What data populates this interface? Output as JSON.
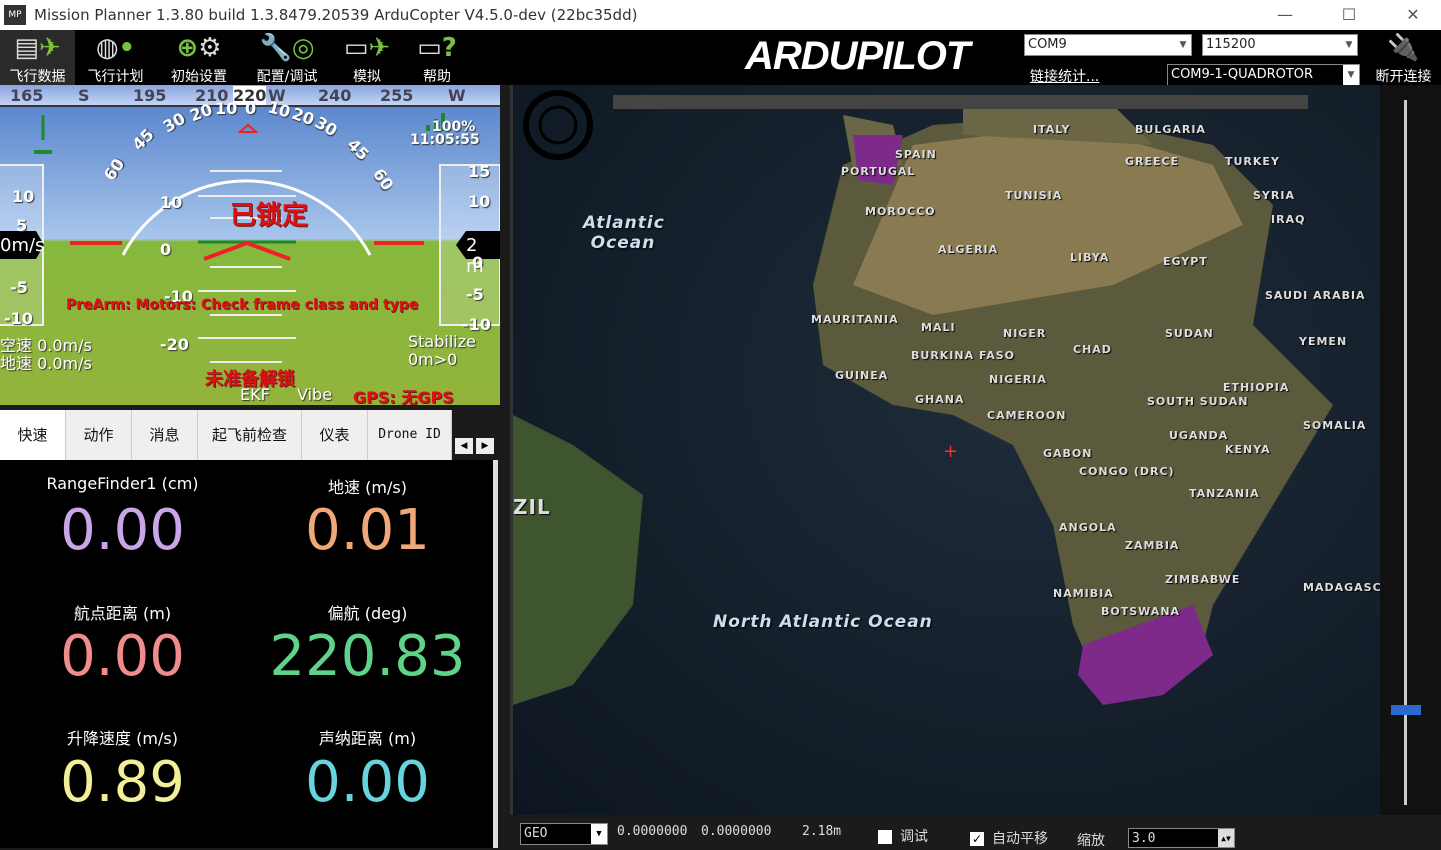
{
  "window": {
    "title": "Mission Planner 1.3.80 build 1.3.8479.20539 ArduCopter V4.5.0-dev (22bc35dd)",
    "logo": "MP",
    "minimize": "—",
    "maximize": "☐",
    "close": "✕"
  },
  "toolbar": {
    "items": [
      {
        "label": "飞行数据",
        "icon": "flight-data-icon"
      },
      {
        "label": "飞行计划",
        "icon": "globe-icon"
      },
      {
        "label": "初始设置",
        "icon": "gear-icon"
      },
      {
        "label": "配置/调试",
        "icon": "wrench-icon"
      },
      {
        "label": "模拟",
        "icon": "monitor-icon"
      },
      {
        "label": "帮助",
        "icon": "help-icon"
      }
    ],
    "brand": "ARDUPILOT",
    "port": "COM9",
    "baud": "115200",
    "link_stats": "链接统计...",
    "vehicle": "COM9-1-QUADROTOR",
    "disconnect": "断开连接"
  },
  "hud": {
    "heading_ticks": [
      "165",
      "S",
      "195",
      "210",
      "220",
      "W",
      "240",
      "255",
      "W"
    ],
    "roll_scale": [
      "60",
      "45",
      "30",
      "20",
      "10",
      "0",
      "10",
      "20",
      "30",
      "45",
      "60"
    ],
    "battery": "100%",
    "time": "11:05:55",
    "pitch": [
      "10",
      "0",
      "-10",
      "-20"
    ],
    "speed_ticks": [
      "10",
      "5",
      "-5",
      "-10"
    ],
    "speed_readout": "0m/s",
    "alt_ticks": [
      "15",
      "10",
      "0",
      "-5",
      "-10"
    ],
    "alt_readout": "2 m",
    "armed_status": "已锁定",
    "prearm": "PreArm: Motors: Check frame class and type",
    "airspeed": "空速 0.0m/s",
    "groundspeed": "地速 0.0m/s",
    "mode": "Stabilize",
    "wp": "0m>0",
    "not_ready": "未准备解锁",
    "ekf": "EKF",
    "vibe": "Vibe",
    "gps": "GPS: 无GPS"
  },
  "tabs": [
    "快速",
    "动作",
    "消息",
    "起飞前检查",
    "仪表",
    "Drone ID"
  ],
  "quick": [
    {
      "label": "RangeFinder1 (cm)",
      "value": "0.00",
      "color": "#c9a6e8"
    },
    {
      "label": "地速 (m/s)",
      "value": "0.01",
      "color": "#f0a878"
    },
    {
      "label": "航点距离 (m)",
      "value": "0.00",
      "color": "#f08c8c"
    },
    {
      "label": "偏航 (deg)",
      "value": "220.83",
      "color": "#5fd38a"
    },
    {
      "label": "升降速度 (m/s)",
      "value": "0.89",
      "color": "#f3ee9a"
    },
    {
      "label": "声纳距离 (m)",
      "value": "0.00",
      "color": "#67d3dc"
    }
  ],
  "map": {
    "countries": [
      "ITALY",
      "BULGARIA",
      "SPAIN",
      "PORTUGAL",
      "GREECE",
      "TURKEY",
      "MOROCCO",
      "TUNISIA",
      "SYRIA",
      "IRAQ",
      "ALGERIA",
      "LIBYA",
      "EGYPT",
      "SAUDI ARABIA",
      "MAURITANIA",
      "MALI",
      "NIGER",
      "CHAD",
      "SUDAN",
      "YEMEN",
      "BURKINA FASO",
      "NIGERIA",
      "GUINEA",
      "ETHIOPIA",
      "GHANA",
      "SOUTH SUDAN",
      "CAMEROON",
      "SOMALIA",
      "UGANDA",
      "GABON",
      "KENYA",
      "CONGO (DRC)",
      "TANZANIA",
      "ANGOLA",
      "ZAMBIA",
      "ZIMBABWE",
      "NAMIBIA",
      "BOTSWANA",
      "MADAGASCAR",
      "ZIL"
    ],
    "oceans": [
      "Atlantic Ocean",
      "North Atlantic Ocean"
    ]
  },
  "bottom": {
    "coord_system": "GEO",
    "lat": "0.0000000",
    "lng": "0.0000000",
    "alt": "2.18m",
    "debug_label": "调试",
    "debug_checked": false,
    "autopan_label": "自动平移",
    "autopan_checked": true,
    "zoom_label": "缩放",
    "zoom_value": "3.0"
  }
}
